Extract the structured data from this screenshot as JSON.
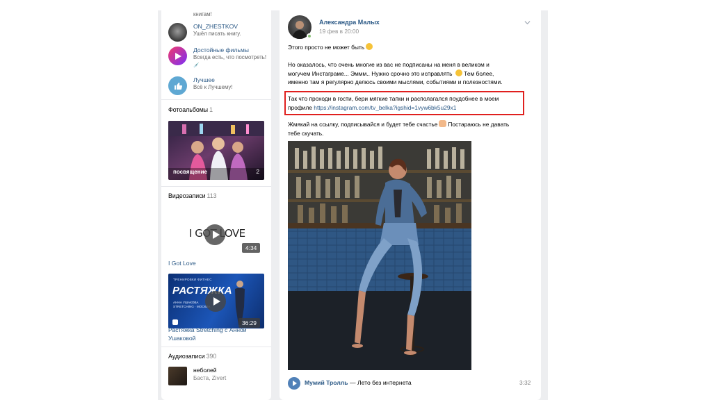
{
  "groups": [
    {
      "name": "",
      "sub": "книгам!"
    },
    {
      "name": "ON_ZHESTKOV",
      "sub": "Ушёл писать книгу."
    },
    {
      "name": "Достойные фильмы",
      "sub": "Всегда есть, что посмотреть!",
      "sub_icon": "💉"
    },
    {
      "name": "Лучшее",
      "sub": "Всё к Лучшему!"
    }
  ],
  "photo_albums": {
    "title": "Фотоальбомы",
    "count": "1",
    "album_label": "посвящение",
    "album_count": "2"
  },
  "videos": {
    "title": "Видеозаписи",
    "count": "113",
    "items": [
      {
        "thumb_text": "I GOT LOVE",
        "duration": "4:34",
        "title": "I Got Love"
      },
      {
        "thumb_top": "ТРЕНИРОВКИ ФИТНЕС",
        "thumb_big": "РАСТЯЖКА",
        "thumb_name": "АННА УШАКОВА",
        "thumb_name2": "STRETCHING · МОСКВА",
        "duration": "36:29",
        "title": "Растяжка Stretching с Анной Ушаковой"
      }
    ]
  },
  "audio": {
    "title": "Аудиозаписи",
    "count": "390",
    "track_title": "неболей",
    "track_artist": "Баста, Zivert"
  },
  "post": {
    "author": "Александра Малых",
    "date": "19 фев в 20:00",
    "p1": "Этого просто не может быть",
    "p2a": "Но оказалось, что очень многие из вас не подписаны на меня в великом и",
    "p2b": "могучем Инстаграме... Эммм.. Нужно срочно это исправлять",
    "p2c": "Тем более,",
    "p2d": "именно там я регулярно делюсь своими мыслями, событиями и полезностями.",
    "p3a": "Так что проходи в гости, бери мягкие тапки и располагался поудобнее в моем",
    "p3b": "профиле",
    "link": "https://instagram.com/tv_belka?igshid=1vyw6bk5u29x1",
    "p4a": "Жмякай на ссылку, подписывайся и будет тебе счастье",
    "p4b": "Постараюсь не давать",
    "p4c": "тебе скучать.",
    "audio_artist": "Мумий Тролль",
    "audio_dash": "—",
    "audio_title": "Лето без интернета",
    "audio_duration": "3:32"
  },
  "colors": {
    "link": "#2a5885",
    "accent": "#5181b8",
    "highlight": "#e0201e",
    "online": "#8ac176"
  }
}
